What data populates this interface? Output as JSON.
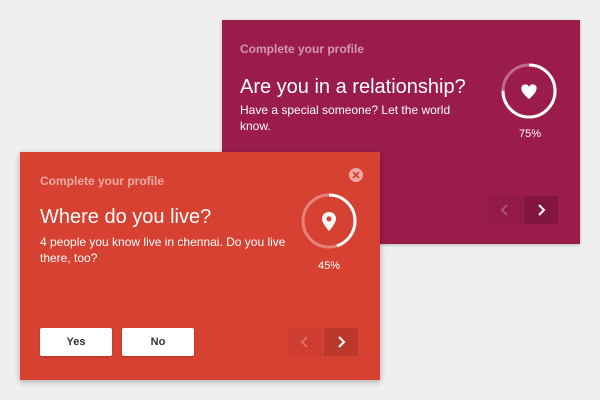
{
  "back_card": {
    "header": "Complete your profile",
    "title": "Are you in a relationship?",
    "description": "Have a special someone? Let the world know.",
    "progress_label": "75%",
    "progress": 0.75,
    "icon": "heart-icon",
    "color": "#9b1b4a"
  },
  "front_card": {
    "header": "Complete your profile",
    "title": "Where do you live?",
    "description": "4 people you know live in chennai. Do you live there, too?",
    "progress_label": "45%",
    "progress": 0.45,
    "icon": "location-pin-icon",
    "color": "#d74132",
    "yes_label": "Yes",
    "no_label": "No"
  },
  "colors": {
    "background": "#efefef",
    "back_card": "#9b1b4a",
    "front_card": "#d74132"
  }
}
